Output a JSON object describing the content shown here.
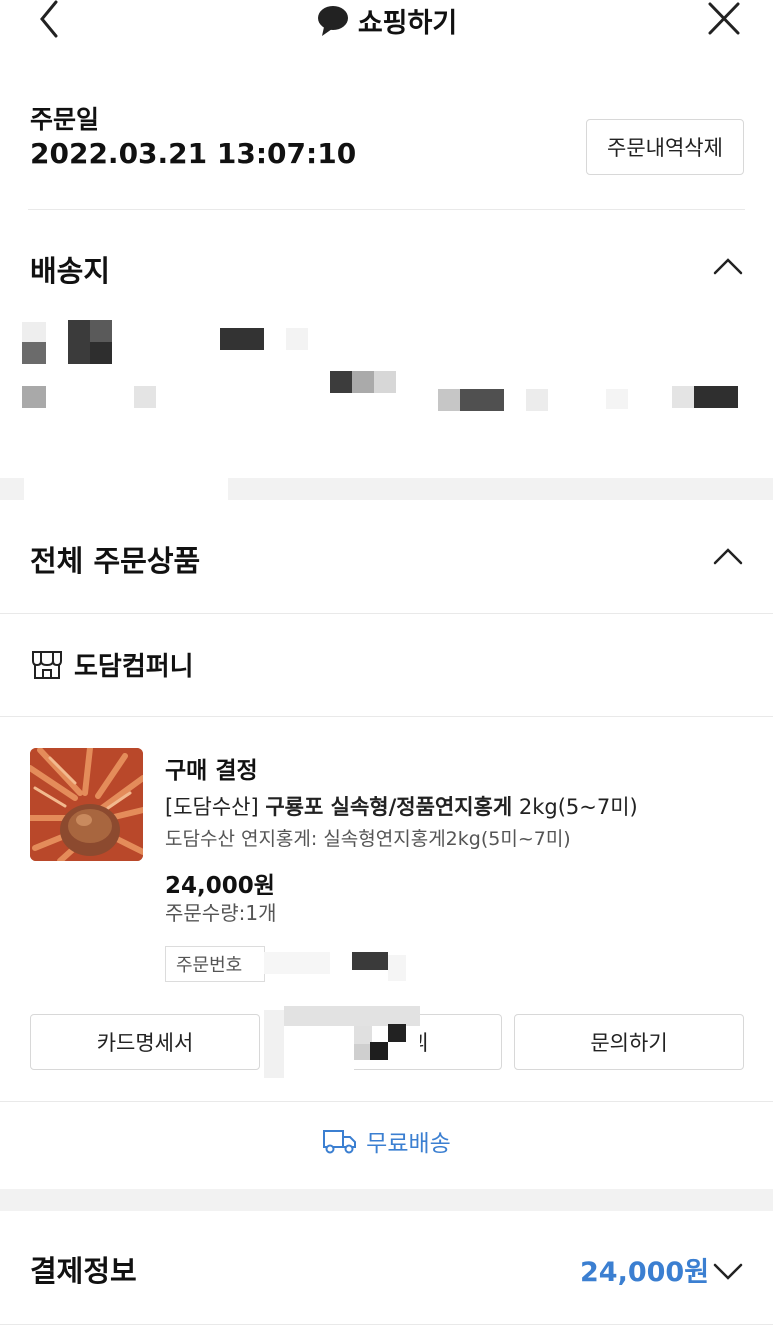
{
  "header": {
    "title": "쇼핑하기"
  },
  "order": {
    "date_label": "주문일",
    "date_value": "2022.03.21 13:07:10",
    "delete_button": "주문내역삭제"
  },
  "shipping": {
    "title": "배송지"
  },
  "products_section": {
    "title": "전체 주문상품",
    "seller": "도담컴퍼니"
  },
  "item": {
    "status": "구매 결정",
    "name_prefix": "[도담수산]",
    "name_bold": "구룡포 실속형/정품연지홍게",
    "name_suffix": "2kg(5~7미)",
    "option": "도담수산 연지홍게: 실속형연지홍게2kg(5미~7미)",
    "price": "24,000원",
    "quantity": "주문수량:1개",
    "order_no_label": "주문번호"
  },
  "actions": {
    "card_receipt": "카드명세서",
    "middle_suffix": "긔",
    "inquiry": "문의하기"
  },
  "delivery": {
    "label": "무료배송"
  },
  "payment": {
    "title": "결제정보",
    "amount": "24,000원"
  },
  "colors": {
    "accent_blue": "#3b7fd1"
  }
}
